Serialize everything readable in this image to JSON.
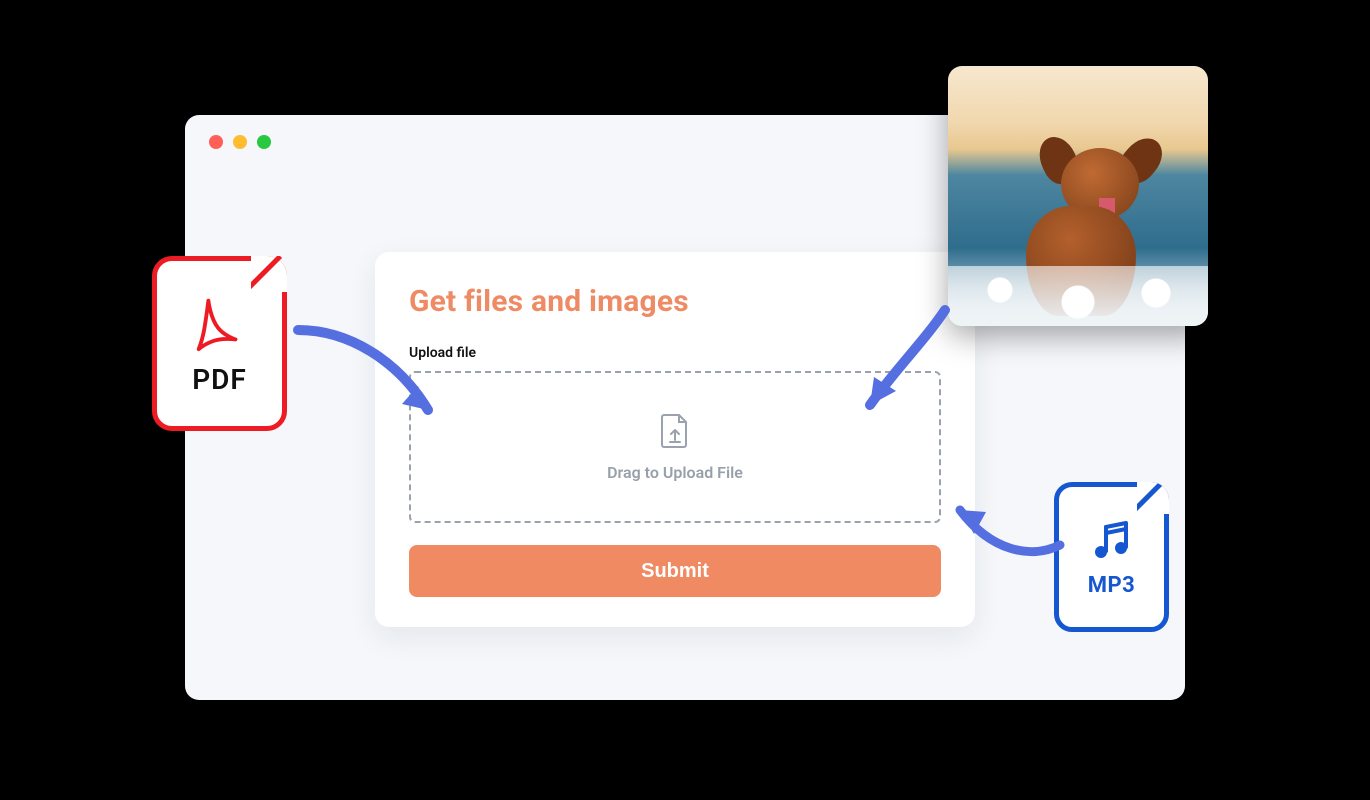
{
  "card": {
    "title": "Get files and images",
    "upload_label": "Upload file",
    "dropzone_text": "Drag to Upload File",
    "submit_label": "Submit"
  },
  "floaters": {
    "pdf_label": "PDF",
    "mp3_label": "MP3"
  }
}
